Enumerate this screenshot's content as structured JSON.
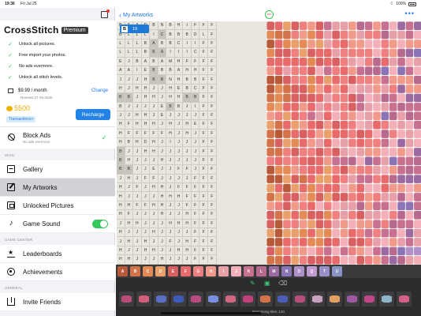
{
  "status_bar": {
    "time": "19:36",
    "date": "Fri Jul 25",
    "battery": "100%"
  },
  "sidebar": {
    "brand": "CrossStitch",
    "badge": "Premium",
    "features": [
      "Unlock all pictures.",
      "Free import your photos.",
      "No ads evermore.",
      "Unlock all stitch levels."
    ],
    "plan_price": "$9.99 / month",
    "plan_renew": "Renews 07-25-2025",
    "change_label": "Change",
    "coins": "5500",
    "recharge_label": "Recharge",
    "transactions_label": "Transactions>",
    "block_ads": {
      "title": "Block Ads",
      "subtitle": "No ads evermore"
    },
    "sections": {
      "main": "MAIN",
      "game_center": "GAME CENTER",
      "general": "GENERAL"
    },
    "items": [
      {
        "label": "Gallery",
        "icon": "gallery-icon"
      },
      {
        "label": "My Artworks",
        "icon": "artworks-icon",
        "active": true
      },
      {
        "label": "Unlocked Pictures",
        "icon": "unlocked-icon"
      },
      {
        "label": "Game Sound",
        "icon": "music-note-icon",
        "toggle": true
      },
      {
        "label": "Leaderboards",
        "icon": "leaderboard-icon"
      },
      {
        "label": "Achievements",
        "icon": "achievement-icon"
      },
      {
        "label": "Invite Friends",
        "icon": "invite-icon"
      }
    ]
  },
  "main": {
    "back_label": "My Artworks",
    "progress": "48%",
    "selected_code": {
      "letter": "B",
      "count": "19"
    },
    "remaining": "Remaining tiles: 140",
    "grid": [
      [
        "B",
        "A",
        "A",
        "D",
        "B",
        "N",
        "B",
        "H",
        "I",
        "F",
        "F",
        "F"
      ],
      [
        "B",
        "L",
        "L",
        "L",
        "I",
        "C",
        "B",
        "B",
        "B",
        "D",
        "L",
        "F"
      ],
      [
        "L",
        "L",
        "L",
        "B",
        "A",
        "B",
        "B",
        "C",
        "I",
        "I",
        "F",
        "F"
      ],
      [
        "L",
        "L",
        "L",
        "B",
        "B",
        "A",
        "I",
        "I",
        "I",
        "C",
        "F",
        "F"
      ],
      [
        "E",
        "J",
        "B",
        "A",
        "B",
        "A",
        "M",
        "H",
        "F",
        "F",
        "F",
        "F"
      ],
      [
        "A",
        "A",
        "I",
        "E",
        "B",
        "B",
        "B",
        "A",
        "H",
        "H",
        "F",
        "F"
      ],
      [
        "J",
        "J",
        "J",
        "H",
        "B",
        "B",
        "N",
        "H",
        "B",
        "B",
        "F",
        "F"
      ],
      [
        "H",
        "J",
        "H",
        "H",
        "J",
        "J",
        "H",
        "E",
        "B",
        "C",
        "F",
        "F"
      ],
      [
        "B",
        "B",
        "J",
        "H",
        "H",
        "J",
        "H",
        "H",
        "B",
        "B",
        "F",
        "F"
      ],
      [
        "B",
        "J",
        "J",
        "J",
        "J",
        "E",
        "B",
        "B",
        "J",
        "I",
        "F",
        "F"
      ],
      [
        "J",
        "J",
        "H",
        "H",
        "J",
        "E",
        "J",
        "J",
        "J",
        "J",
        "F",
        "F"
      ],
      [
        "H",
        "F",
        "H",
        "H",
        "H",
        "J",
        "H",
        "J",
        "H",
        "E",
        "F",
        "F"
      ],
      [
        "H",
        "F",
        "F",
        "F",
        "F",
        "F",
        "H",
        "J",
        "H",
        "J",
        "F",
        "F"
      ],
      [
        "H",
        "B",
        "H",
        "D",
        "H",
        "J",
        "I",
        "J",
        "J",
        "J",
        "F",
        "F"
      ],
      [
        "B",
        "J",
        "J",
        "H",
        "H",
        "J",
        "J",
        "J",
        "J",
        "J",
        "F",
        "F"
      ],
      [
        "B",
        "H",
        "J",
        "J",
        "J",
        "H",
        "J",
        "J",
        "J",
        "J",
        "F",
        "F"
      ],
      [
        "B",
        "B",
        "J",
        "J",
        "E",
        "J",
        "J",
        "F",
        "F",
        "J",
        "F",
        "F"
      ],
      [
        "J",
        "H",
        "J",
        "F",
        "F",
        "J",
        "J",
        "J",
        "J",
        "F",
        "F",
        "F"
      ],
      [
        "H",
        "J",
        "F",
        "J",
        "H",
        "H",
        "J",
        "F",
        "F",
        "F",
        "F",
        "F"
      ],
      [
        "H",
        "J",
        "J",
        "J",
        "J",
        "H",
        "H",
        "H",
        "F",
        "F",
        "F",
        "F"
      ],
      [
        "H",
        "H",
        "F",
        "F",
        "H",
        "H",
        "J",
        "J",
        "F",
        "F",
        "F",
        "F"
      ],
      [
        "H",
        "F",
        "J",
        "J",
        "J",
        "H",
        "J",
        "J",
        "H",
        "F",
        "F",
        "F"
      ],
      [
        "J",
        "H",
        "H",
        "J",
        "J",
        "J",
        "H",
        "H",
        "H",
        "F",
        "F",
        "F"
      ],
      [
        "H",
        "J",
        "J",
        "J",
        "H",
        "J",
        "J",
        "J",
        "J",
        "F",
        "F",
        "F"
      ],
      [
        "J",
        "H",
        "J",
        "H",
        "J",
        "J",
        "F",
        "J",
        "H",
        "F",
        "F",
        "F"
      ],
      [
        "H",
        "J",
        "J",
        "H",
        "H",
        "J",
        "J",
        "H",
        "H",
        "F",
        "F",
        "F"
      ],
      [
        "H",
        "H",
        "J",
        "J",
        "J",
        "H",
        "J",
        "J",
        "J",
        "F",
        "F",
        "F"
      ]
    ],
    "highlight_cells": [
      [
        1,
        5
      ],
      [
        2,
        4
      ],
      [
        3,
        4
      ],
      [
        3,
        5
      ],
      [
        5,
        4
      ],
      [
        6,
        4
      ],
      [
        6,
        5
      ],
      [
        8,
        0
      ],
      [
        8,
        1
      ],
      [
        8,
        8
      ],
      [
        8,
        9
      ],
      [
        9,
        6
      ],
      [
        14,
        0
      ],
      [
        15,
        0
      ],
      [
        16,
        0
      ],
      [
        16,
        1
      ]
    ],
    "palette": [
      {
        "letter": "A",
        "color": "#b85a3a"
      },
      {
        "letter": "B",
        "color": "#d4734a"
      },
      {
        "letter": "C",
        "color": "#e48a55"
      },
      {
        "letter": "D",
        "color": "#e9a06a"
      },
      {
        "letter": "E",
        "color": "#d96060"
      },
      {
        "letter": "F",
        "color": "#e86a6a"
      },
      {
        "letter": "G",
        "color": "#f08080"
      },
      {
        "letter": "H",
        "color": "#f29a8a"
      },
      {
        "letter": "I",
        "color": "#e8a0a8"
      },
      {
        "letter": "J",
        "color": "#f4b0b8"
      },
      {
        "letter": "K",
        "color": "#c87090"
      },
      {
        "letter": "L",
        "color": "#b86a8e"
      },
      {
        "letter": "M",
        "color": "#9a6aa0"
      },
      {
        "letter": "N",
        "color": "#8a74b6"
      },
      {
        "letter": "O",
        "color": "#b090c8"
      },
      {
        "letter": "Q",
        "color": "#c09ad0"
      },
      {
        "letter": "T",
        "color": "#9a8ec8"
      },
      {
        "letter": "U",
        "color": "#8894c6"
      }
    ],
    "pieces": [
      "#b84d7a",
      "#d25e7c",
      "#5b6ec6",
      "#3d5ab8",
      "#b94b83",
      "#7b8fe0",
      "#d06880",
      "#c0407a",
      "#d4734a",
      "#4c5bb6",
      "#b74f7c",
      "#c8a0c0",
      "#e0a062",
      "#9e5aa0",
      "#c04888",
      "#8eb4c8",
      "#d26088"
    ]
  }
}
